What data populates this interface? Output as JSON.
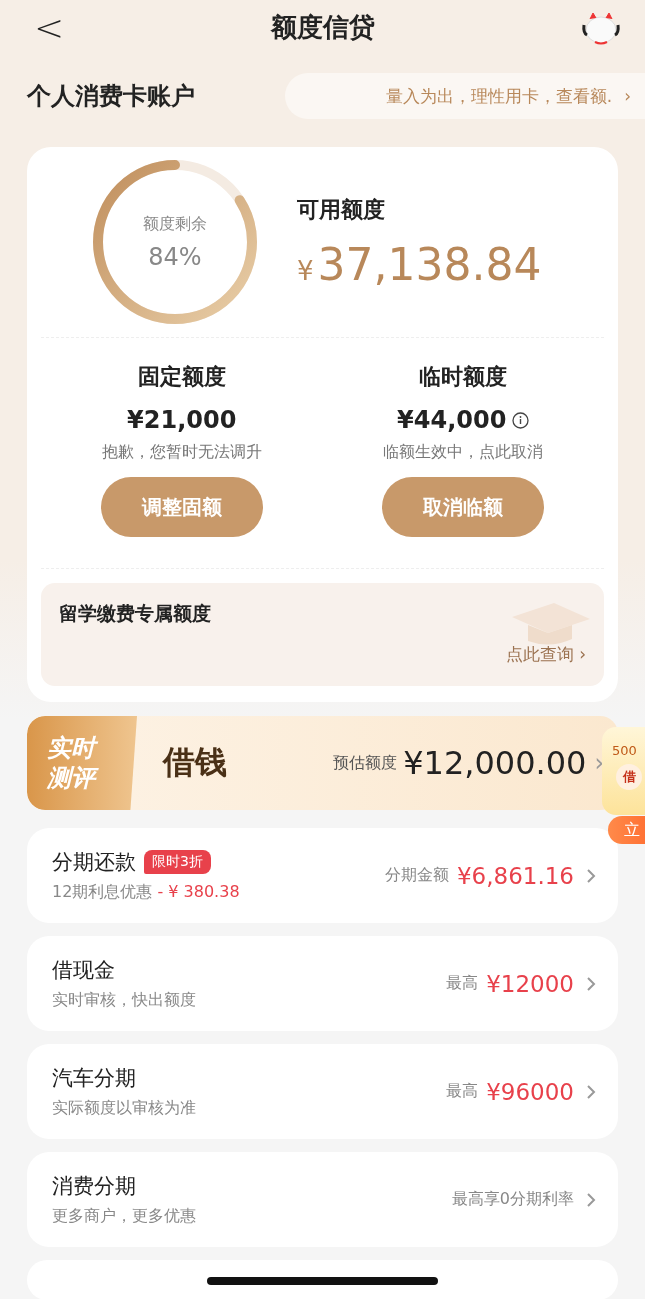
{
  "header": {
    "back": "<",
    "title": "额度信贷"
  },
  "account": {
    "title": "个人消费卡账户",
    "notice": "量入为出，理性用卡，查看额.",
    "notice_arrow": "›"
  },
  "quota": {
    "ring_label": "额度剩余",
    "ring_value": "84%",
    "level": 0.84,
    "available_label": "可用额度",
    "currency": "¥",
    "available": "37,138.84",
    "columns": [
      {
        "title": "固定额度",
        "amount": "¥21,000",
        "info": false,
        "note": "抱歉，您暂时无法调升",
        "button": "调整固额"
      },
      {
        "title": "临时额度",
        "amount": "¥44,000",
        "info": true,
        "note": "临额生效中，点此取消",
        "button": "取消临额"
      }
    ],
    "study": {
      "title": "留学缴费专属额度",
      "link": "点此查询",
      "arrow": "›"
    }
  },
  "banner": {
    "tag": [
      "实时",
      "测评"
    ],
    "title": "借钱",
    "label": "预估额度",
    "amount": "¥12,000.00",
    "arrow": "›"
  },
  "float": {
    "amount": "500",
    "badge": "借",
    "button": "立"
  },
  "rows": [
    {
      "title": "分期还款",
      "badge": "限时3折",
      "subtitle": "12期利息优惠",
      "discount": "- ¥ 380.38",
      "right_label": "分期金额",
      "right_amount": "¥6,861.16"
    },
    {
      "title": "借现金",
      "subtitle": "实时审核，快出额度",
      "right_label": "最高",
      "right_amount": "¥12000"
    },
    {
      "title": "汽车分期",
      "subtitle": "实际额度以审核为准",
      "right_label": "最高",
      "right_amount": "¥96000"
    },
    {
      "title": "消费分期",
      "subtitle": "更多商户，更多优惠",
      "right_label": "最高享0分期利率"
    }
  ]
}
